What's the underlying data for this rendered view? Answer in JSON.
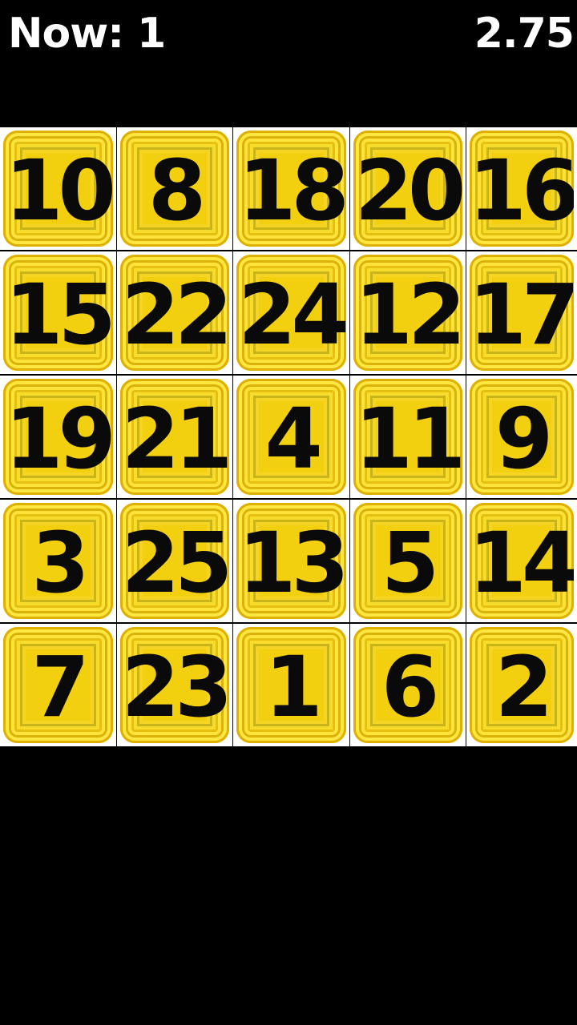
{
  "hud": {
    "now_label": "Now: 1",
    "time": "2.75"
  },
  "colors": {
    "background": "#000000",
    "tile_yellow": "#f2cf0f",
    "cell_border": "#ffffff",
    "number": "#0a0a0a"
  },
  "board": {
    "rows": [
      [
        "10",
        "8",
        "18",
        "20",
        "16"
      ],
      [
        "15",
        "22",
        "24",
        "12",
        "17"
      ],
      [
        "19",
        "21",
        "4",
        "11",
        "9"
      ],
      [
        "3",
        "25",
        "13",
        "5",
        "14"
      ],
      [
        "7",
        "23",
        "1",
        "6",
        "2"
      ]
    ]
  }
}
